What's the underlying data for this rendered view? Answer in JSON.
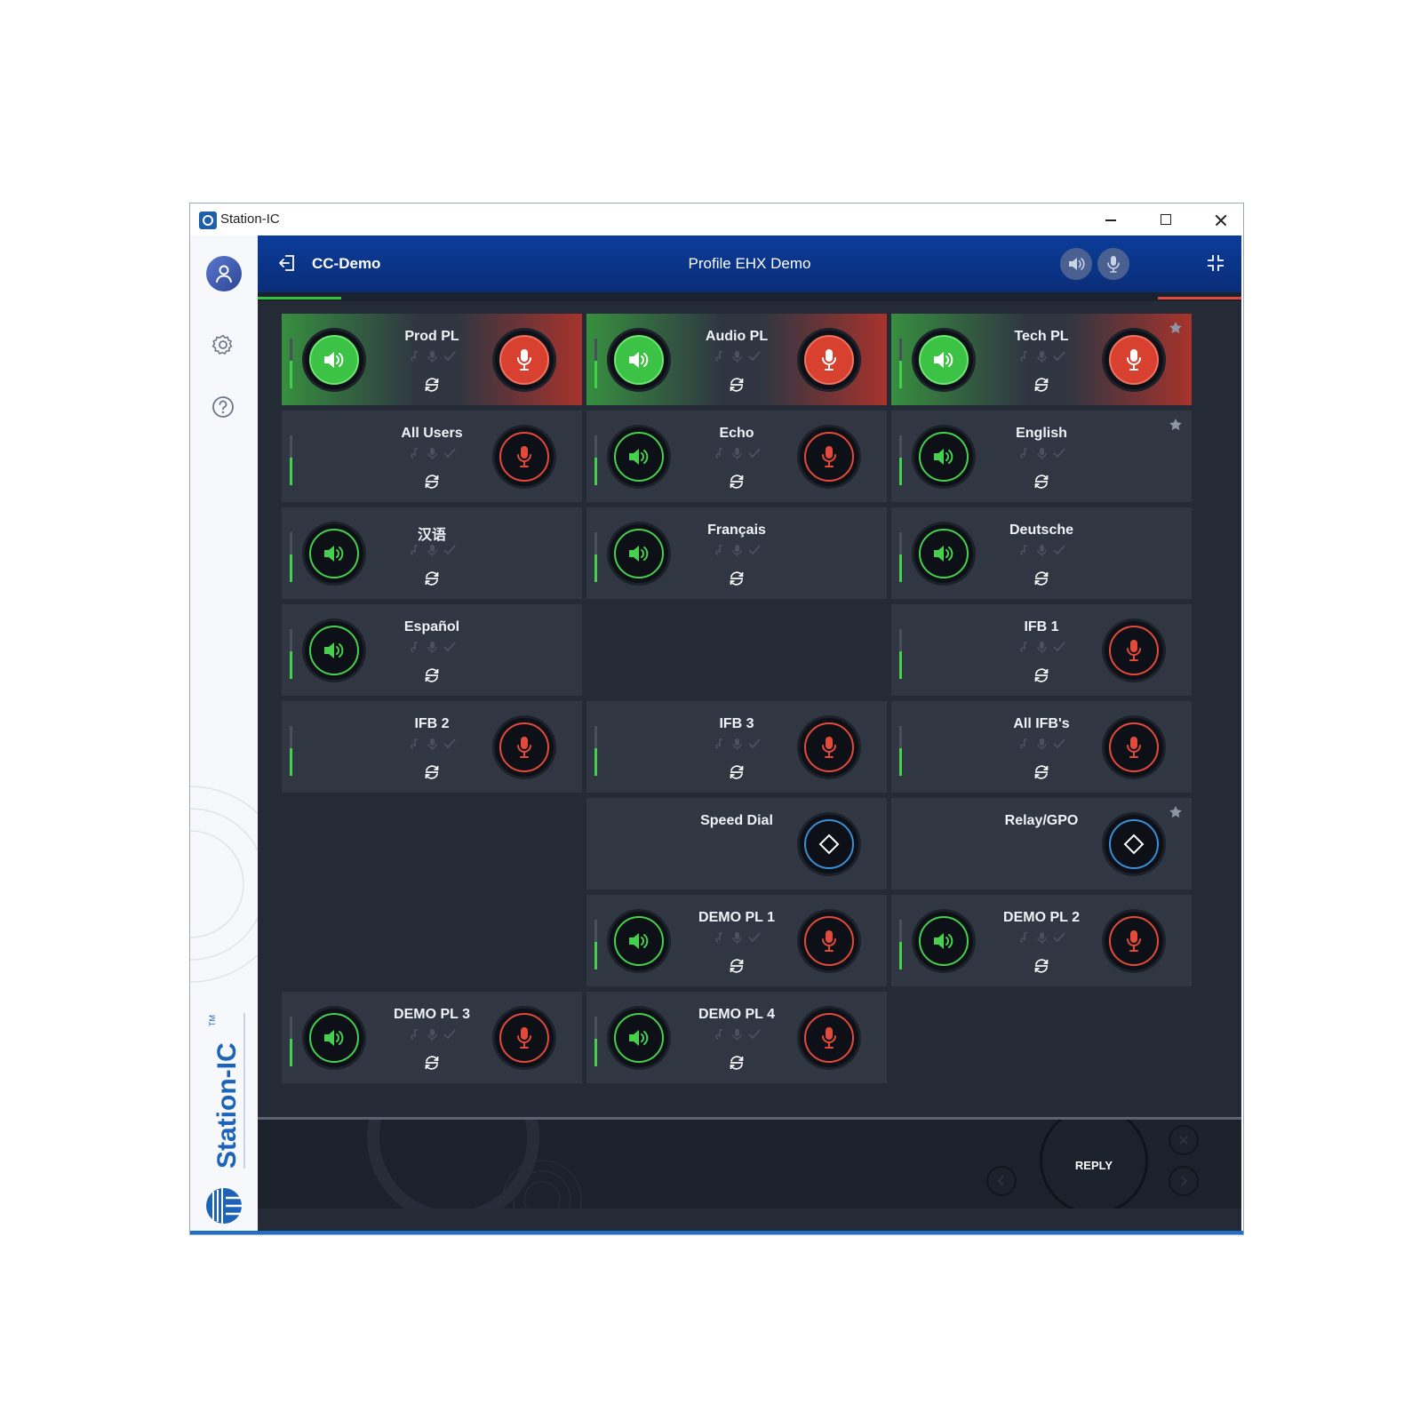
{
  "window": {
    "title": "Station-IC"
  },
  "sidebar": {
    "items": [
      {
        "icon": "user-icon",
        "label": "Profile"
      },
      {
        "icon": "gear-icon",
        "label": "Settings"
      },
      {
        "icon": "help-icon",
        "label": "Help"
      }
    ],
    "brand": "Station-IC",
    "trademark": "TM"
  },
  "header": {
    "session": "CC-Demo",
    "profile": "Profile EHX Demo",
    "colors": {
      "bar": "#0b3c9a",
      "talk": "#45d14e",
      "listen_accent": "#34c23e",
      "mic": "#e44a3a",
      "dial": "#3a8fd8"
    }
  },
  "tiles": [
    {
      "name": "Prod PL",
      "talk": true,
      "mic": true,
      "active": true,
      "level": true
    },
    {
      "name": "Audio PL",
      "talk": true,
      "mic": true,
      "active": true,
      "level": true
    },
    {
      "name": "Tech PL",
      "talk": true,
      "mic": true,
      "active": true,
      "level": true,
      "star": true
    },
    {
      "name": "All Users",
      "talk": false,
      "mic": true,
      "level": true
    },
    {
      "name": "Echo",
      "talk": true,
      "mic": true,
      "level": true
    },
    {
      "name": "English",
      "talk": true,
      "mic": false,
      "level": true,
      "star": true
    },
    {
      "name": "汉语",
      "talk": true,
      "mic": false,
      "level": true
    },
    {
      "name": "Français",
      "talk": true,
      "mic": false,
      "level": true
    },
    {
      "name": "Deutsche",
      "talk": true,
      "mic": false,
      "level": true
    },
    {
      "name": "Español",
      "talk": true,
      "mic": false,
      "level": true
    },
    {
      "empty": true
    },
    {
      "name": "IFB 1",
      "talk": false,
      "mic": true,
      "level": true
    },
    {
      "name": "IFB 2",
      "talk": false,
      "mic": true,
      "level": true
    },
    {
      "name": "IFB 3",
      "talk": false,
      "mic": true,
      "level": true
    },
    {
      "name": "All IFB's",
      "talk": false,
      "mic": true,
      "level": true
    },
    {
      "empty": true
    },
    {
      "name": "Speed Dial",
      "dial": true
    },
    {
      "name": "Relay/GPO",
      "dial": true,
      "star": true
    },
    {
      "empty": true
    },
    {
      "name": "DEMO PL 1",
      "talk": true,
      "mic": true,
      "level": true
    },
    {
      "name": "DEMO PL 2",
      "talk": true,
      "mic": true,
      "level": true
    },
    {
      "name": "DEMO PL 3",
      "talk": true,
      "mic": true,
      "level": true
    },
    {
      "name": "DEMO PL 4",
      "talk": true,
      "mic": true,
      "level": true
    },
    {
      "empty": true
    }
  ],
  "footer": {
    "reply": "REPLY"
  }
}
